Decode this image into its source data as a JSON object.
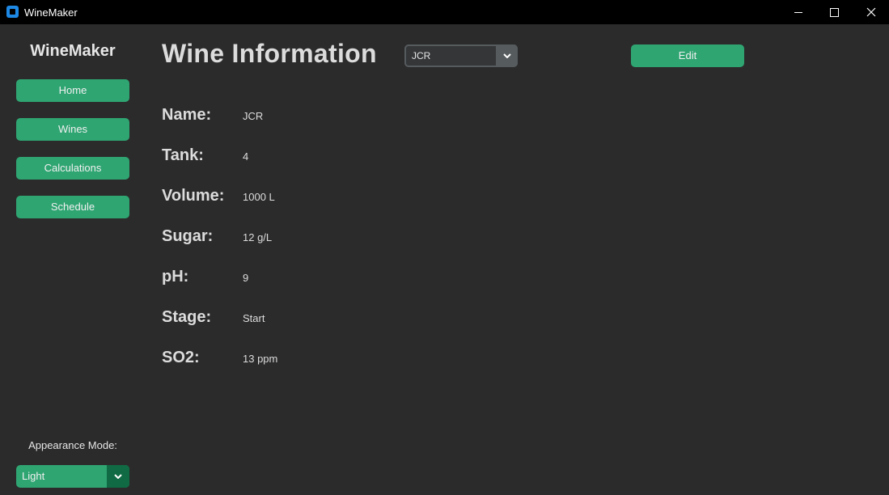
{
  "window": {
    "title": "WineMaker"
  },
  "sidebar": {
    "brand": "WineMaker",
    "nav": [
      {
        "label": "Home"
      },
      {
        "label": "Wines"
      },
      {
        "label": "Calculations"
      },
      {
        "label": "Schedule"
      }
    ],
    "appearance_label": "Appearance Mode:",
    "appearance_value": "Light"
  },
  "main": {
    "title": "Wine Information",
    "wine_select_value": "JCR",
    "edit_label": "Edit",
    "fields": [
      {
        "label": "Name:",
        "value": "JCR"
      },
      {
        "label": "Tank:",
        "value": "4"
      },
      {
        "label": "Volume:",
        "value": "1000 L"
      },
      {
        "label": "Sugar:",
        "value": "12 g/L"
      },
      {
        "label": "pH:",
        "value": "9"
      },
      {
        "label": "Stage:",
        "value": "Start"
      },
      {
        "label": "SO2:",
        "value": "13 ppm"
      }
    ]
  },
  "colors": {
    "accent": "#2fa572",
    "accent_dark": "#106a43",
    "background": "#2b2b2b",
    "titlebar": "#000000"
  }
}
